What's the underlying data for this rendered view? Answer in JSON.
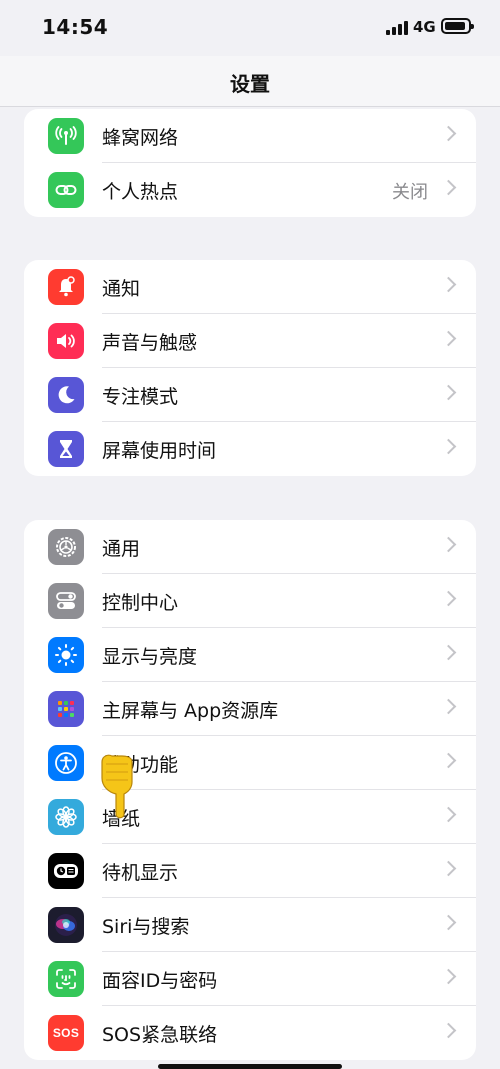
{
  "status_bar": {
    "time": "14:54",
    "network": "4G"
  },
  "nav": {
    "title": "设置"
  },
  "groups": [
    {
      "items": [
        {
          "label": "蜂窝网络",
          "icon": "antenna-icon",
          "color": "#34c759"
        },
        {
          "label": "个人热点",
          "value": "关闭",
          "icon": "chain-link-icon",
          "color": "#34c759"
        }
      ]
    },
    {
      "items": [
        {
          "label": "通知",
          "icon": "bell-icon",
          "color": "#ff3b30"
        },
        {
          "label": "声音与触感",
          "icon": "speaker-icon",
          "color": "#ff2d55"
        },
        {
          "label": "专注模式",
          "icon": "moon-icon",
          "color": "#5856d6"
        },
        {
          "label": "屏幕使用时间",
          "icon": "hourglass-icon",
          "color": "#5856d6"
        }
      ]
    },
    {
      "items": [
        {
          "label": "通用",
          "icon": "gear-icon",
          "color": "#8e8e93"
        },
        {
          "label": "控制中心",
          "icon": "toggles-icon",
          "color": "#8e8e93"
        },
        {
          "label": "显示与亮度",
          "icon": "sun-icon",
          "color": "#007aff"
        },
        {
          "label": "主屏幕与 App资源库",
          "icon": "app-grid-icon",
          "color": "#5856d6"
        },
        {
          "label": "辅助功能",
          "icon": "accessibility-icon",
          "color": "#007aff"
        },
        {
          "label": "墙纸",
          "icon": "flower-icon",
          "color": "#34aadc"
        },
        {
          "label": "待机显示",
          "icon": "standby-icon",
          "color": "#000000"
        },
        {
          "label": "Siri与搜索",
          "icon": "siri-icon",
          "color": "#1c1c2e"
        },
        {
          "label": "面容ID与密码",
          "icon": "face-id-icon",
          "color": "#34c759"
        },
        {
          "label": "SOS紧急联络",
          "icon": "sos-icon",
          "color": "#ff3b30"
        }
      ]
    }
  ]
}
